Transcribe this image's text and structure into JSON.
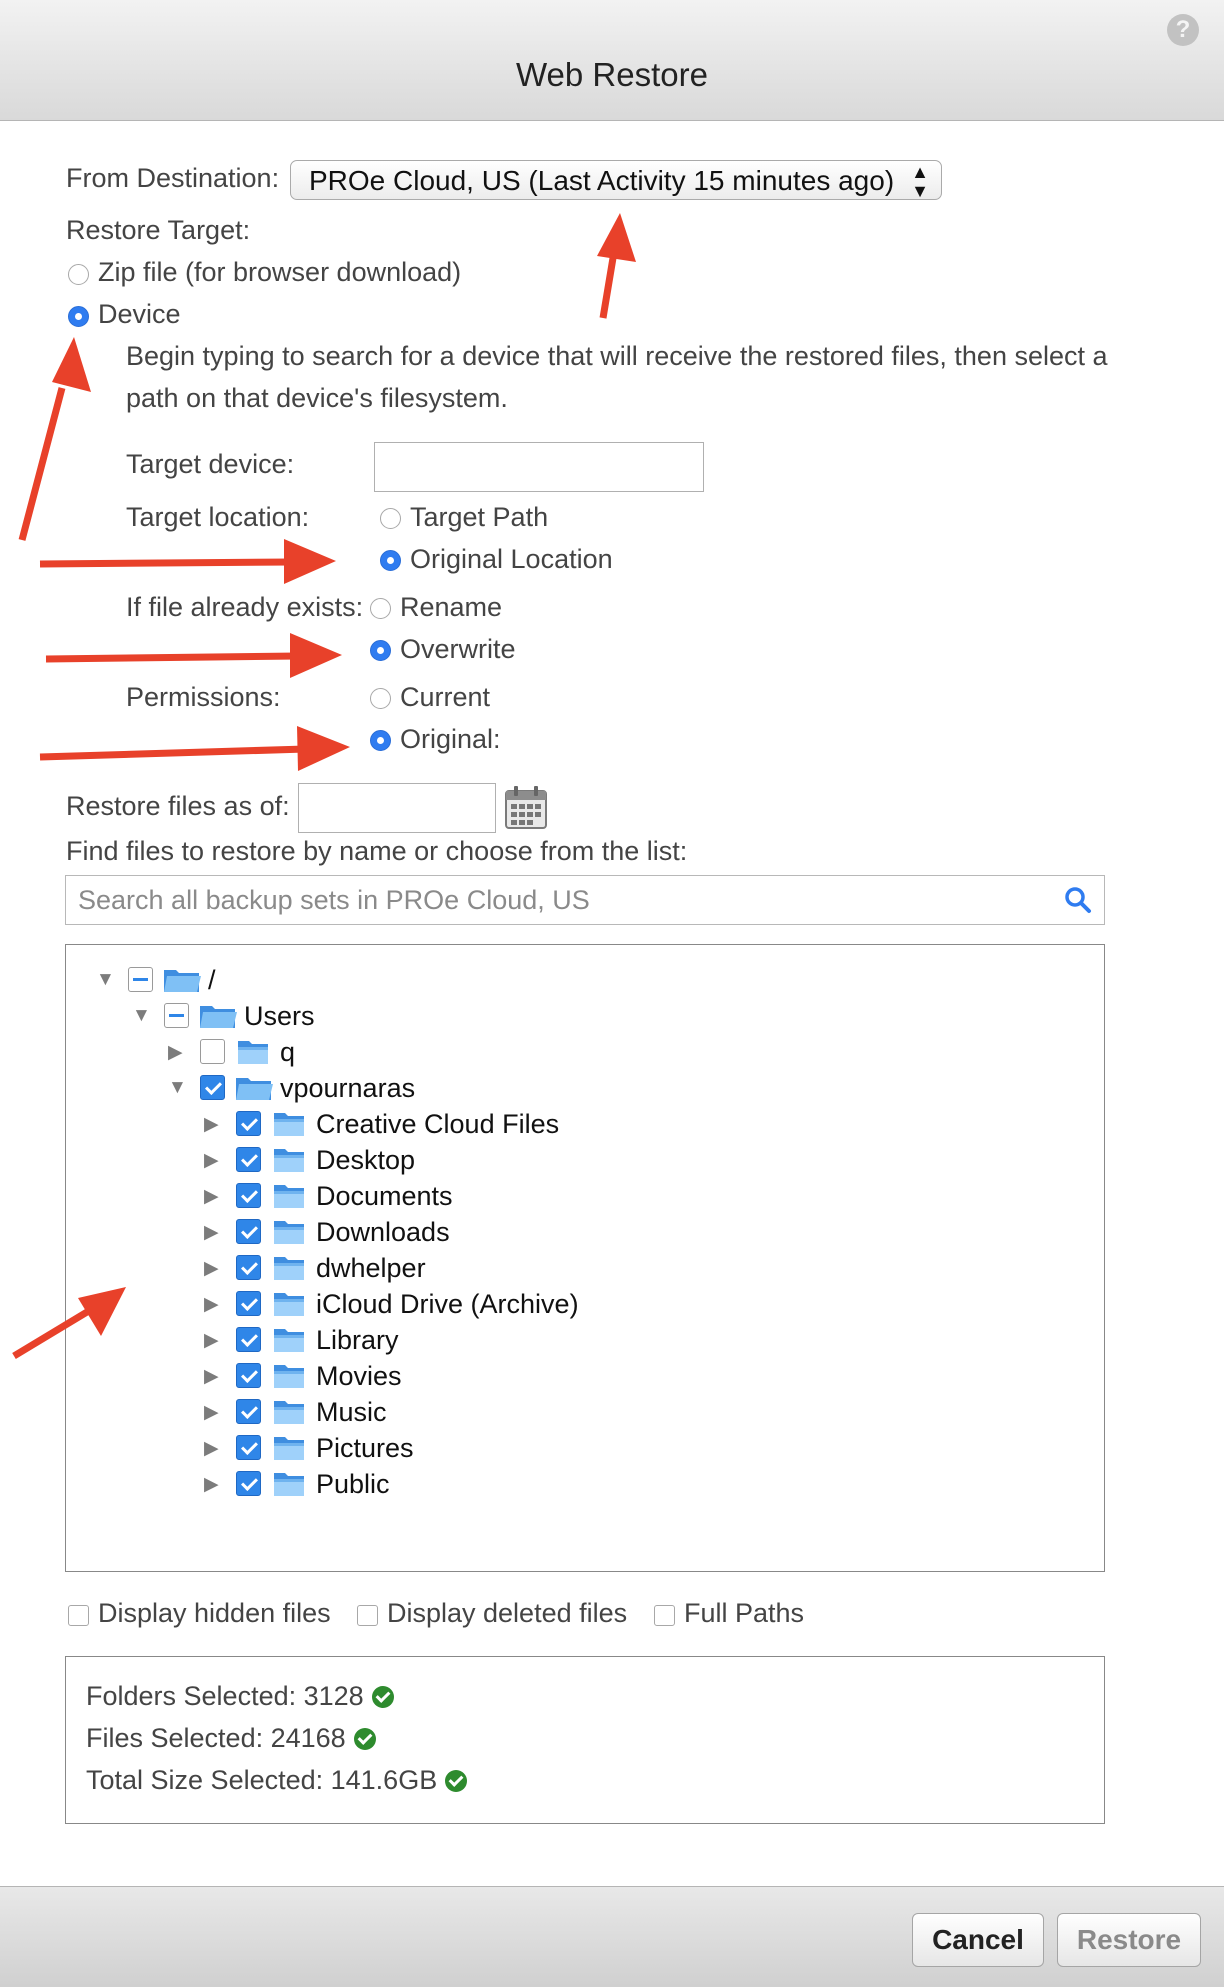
{
  "window": {
    "title": "Web Restore"
  },
  "destination": {
    "label": "From Destination:",
    "selected": "PROe Cloud, US (Last Activity 15 minutes ago)"
  },
  "restore_target": {
    "label": "Restore Target:",
    "zip_label": "Zip file (for browser download)",
    "device_label": "Device",
    "help_line1": "Begin typing to search for a device that will receive the restored files, then select a",
    "help_line2": "path on that device's filesystem.",
    "target_device_label": "Target device:",
    "target_device_value": "",
    "target_location_label": "Target location:",
    "target_path_label": "Target Path",
    "original_location_label": "Original Location",
    "exists_label": "If file already exists:",
    "rename_label": "Rename",
    "overwrite_label": "Overwrite",
    "permissions_label": "Permissions:",
    "current_label": "Current",
    "original_label": "Original:"
  },
  "restore_as_of": {
    "label": "Restore files as of:",
    "value": ""
  },
  "find": {
    "label": "Find files to restore by name or choose from the list:",
    "placeholder": "Search all backup sets in PROe Cloud, US"
  },
  "tree": {
    "root": "/",
    "users": "Users",
    "q": "q",
    "user": "vpournaras",
    "children": [
      "Creative Cloud Files",
      "Desktop",
      "Documents",
      "Downloads",
      "dwhelper",
      "iCloud Drive (Archive)",
      "Library",
      "Movies",
      "Music",
      "Pictures",
      "Public"
    ]
  },
  "options": {
    "hidden": "Display hidden files",
    "deleted": "Display deleted files",
    "full_paths": "Full Paths"
  },
  "summary": {
    "folders": "Folders Selected: 3128",
    "files": "Files Selected: 24168",
    "size": "Total Size Selected: 141.6GB"
  },
  "buttons": {
    "cancel": "Cancel",
    "restore": "Restore"
  },
  "colors": {
    "accent": "#2f7cf0",
    "annotation_arrow": "#e8412a",
    "success": "#2e8b2e"
  }
}
